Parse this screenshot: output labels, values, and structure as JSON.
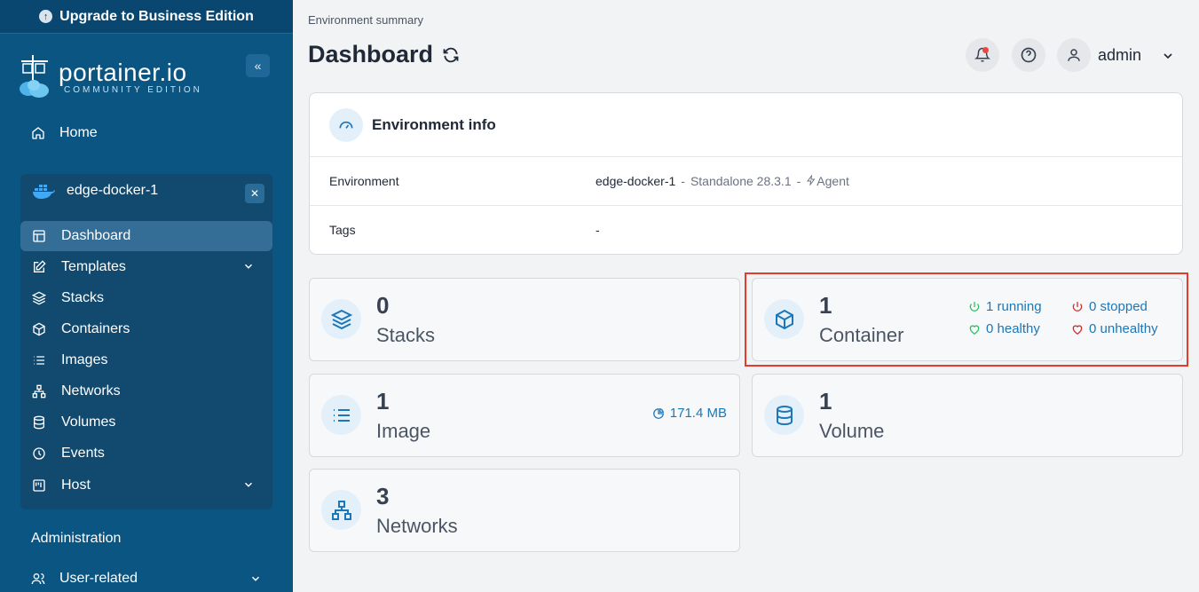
{
  "sidebar": {
    "upgrade_label": "Upgrade to Business Edition",
    "brand_name": "portainer.io",
    "brand_edition": "COMMUNITY EDITION",
    "home_label": "Home",
    "environment_name": "edge-docker-1",
    "env_items": [
      {
        "label": "Dashboard",
        "icon": "layout-icon"
      },
      {
        "label": "Templates",
        "icon": "edit-icon"
      },
      {
        "label": "Stacks",
        "icon": "layers-icon"
      },
      {
        "label": "Containers",
        "icon": "box-icon"
      },
      {
        "label": "Images",
        "icon": "list-icon"
      },
      {
        "label": "Networks",
        "icon": "network-icon"
      },
      {
        "label": "Volumes",
        "icon": "database-icon"
      },
      {
        "label": "Events",
        "icon": "clock-icon"
      },
      {
        "label": "Host",
        "icon": "host-icon"
      }
    ],
    "administration_label": "Administration",
    "user_related_label": "User-related"
  },
  "header": {
    "breadcrumb": "Environment summary",
    "title": "Dashboard",
    "user": "admin"
  },
  "environment_info": {
    "title": "Environment info",
    "environment_label": "Environment",
    "environment_name": "edge-docker-1",
    "sep": "-",
    "environment_type": "Standalone 28.3.1",
    "agent_label": "Agent",
    "tags_label": "Tags",
    "tags_value": "-"
  },
  "stats": {
    "stacks": {
      "count": "0",
      "label": "Stacks"
    },
    "containers": {
      "count": "1",
      "label": "Container",
      "running": "1 running",
      "stopped": "0 stopped",
      "healthy": "0 healthy",
      "unhealthy": "0 unhealthy"
    },
    "images": {
      "count": "1",
      "label": "Image",
      "size": "171.4 MB"
    },
    "volumes": {
      "count": "1",
      "label": "Volume"
    },
    "networks": {
      "count": "3",
      "label": "Networks"
    }
  },
  "colors": {
    "sidebar": "#0b5583",
    "accent": "#1b77b8",
    "highlight": "#e53b2c",
    "running": "#22c55e",
    "stopped": "#dc2626"
  }
}
